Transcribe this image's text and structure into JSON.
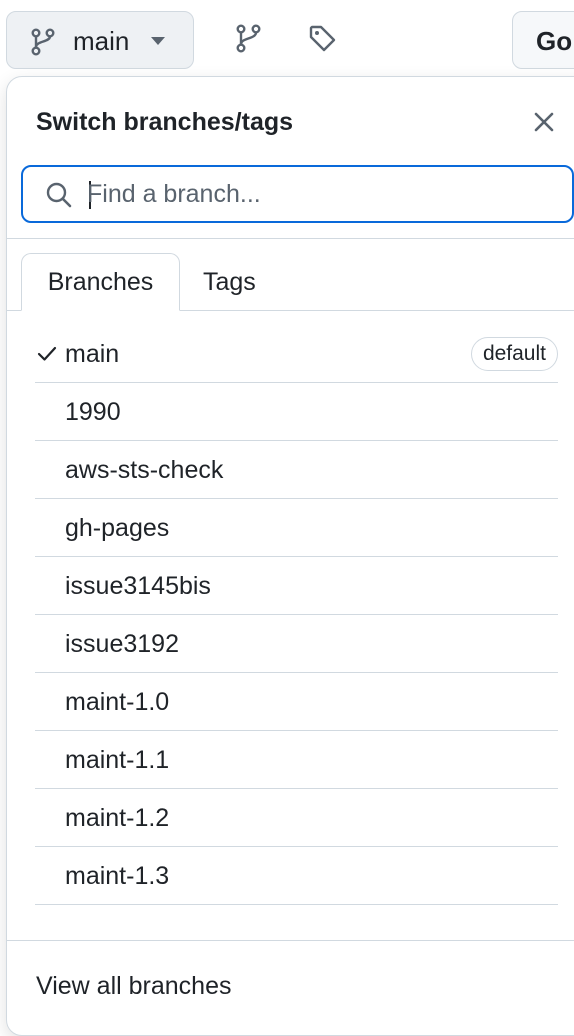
{
  "toolbar": {
    "branch_button_label": "main",
    "go_button_label": "Go",
    "icons": [
      "git-branch-icon",
      "chevron-down-icon",
      "git-branch-icon",
      "tag-icon"
    ]
  },
  "panel": {
    "title": "Switch branches/tags",
    "close_icon": "close-icon",
    "search": {
      "placeholder": "Find a branch...",
      "value": "",
      "icon": "search-icon"
    },
    "tabs": [
      {
        "label": "Branches",
        "active": true
      },
      {
        "label": "Tags",
        "active": false
      }
    ],
    "branches": [
      {
        "name": "main",
        "selected": true,
        "badge": "default"
      },
      {
        "name": "1990"
      },
      {
        "name": "aws-sts-check"
      },
      {
        "name": "gh-pages"
      },
      {
        "name": "issue3145bis"
      },
      {
        "name": "issue3192"
      },
      {
        "name": "maint-1.0"
      },
      {
        "name": "maint-1.1"
      },
      {
        "name": "maint-1.2"
      },
      {
        "name": "maint-1.3"
      }
    ],
    "footer_link": "View all branches"
  },
  "colors": {
    "accent": "#0969da",
    "border": "#d1d9e0",
    "text": "#1f2328",
    "muted": "#59636e",
    "button_bg": "#eef1f4"
  }
}
